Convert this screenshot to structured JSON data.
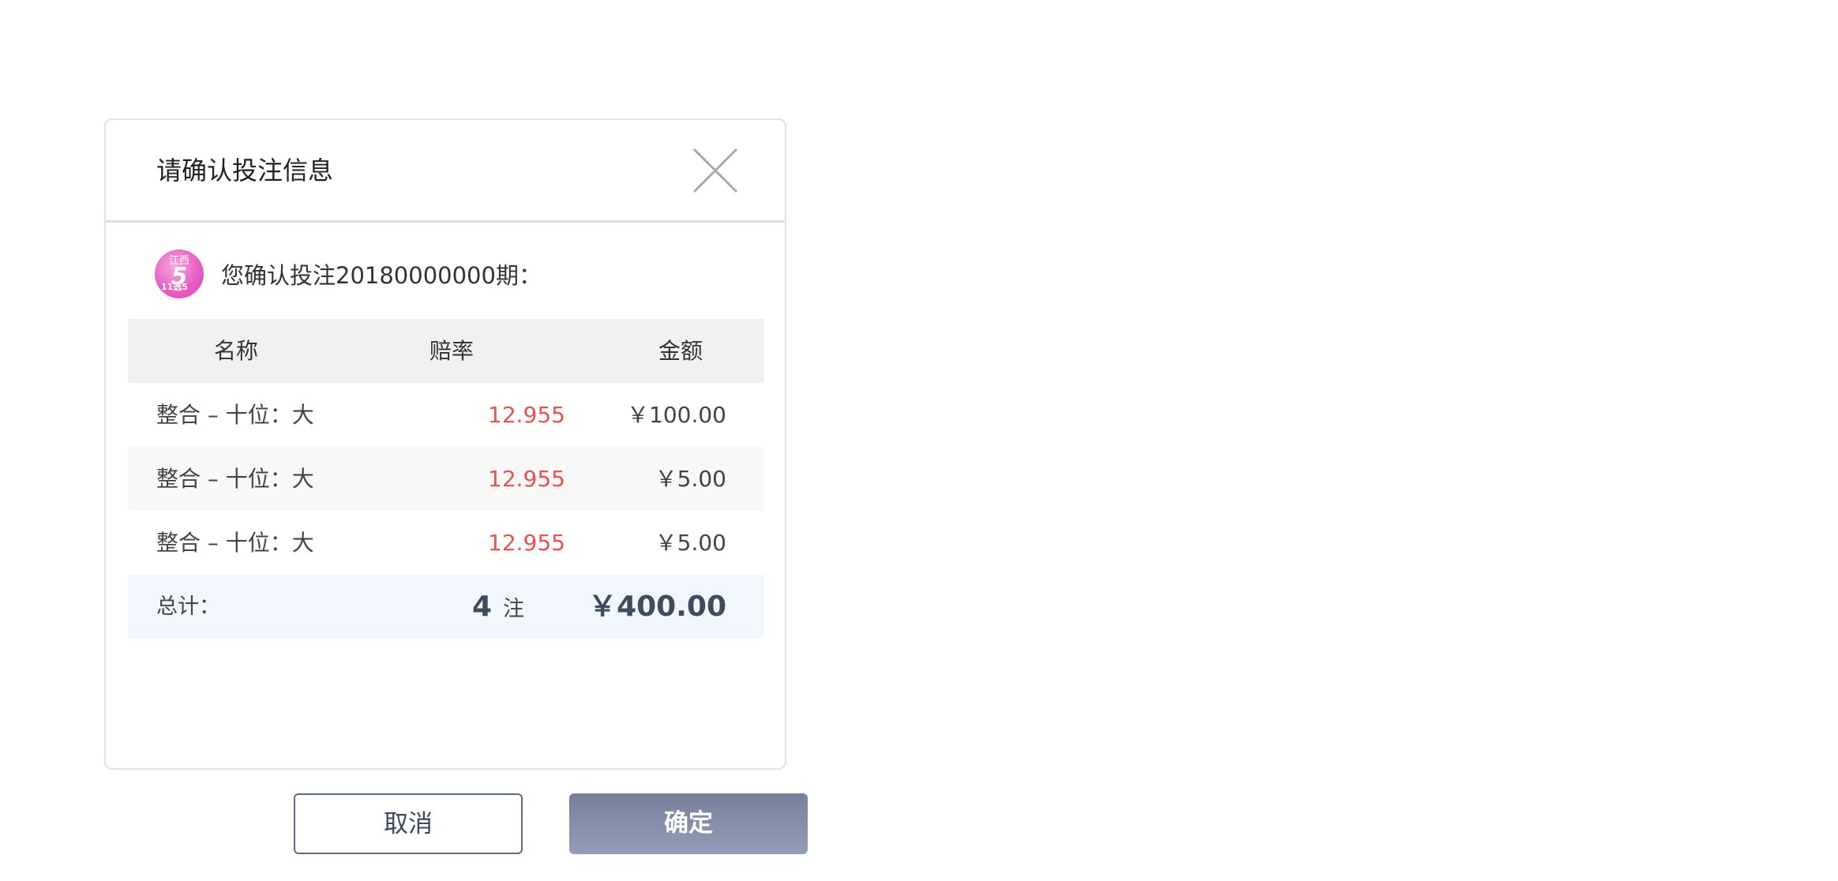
{
  "dialog": {
    "title": "请确认投注信息",
    "close_icon": "close-icon"
  },
  "intro": {
    "logo": {
      "top_text": "江西",
      "number": "5",
      "sub_text": "11选5"
    },
    "text": "您确认投注20180000000期："
  },
  "table": {
    "headers": {
      "name": "名称",
      "odds": "赔率",
      "amount": "金额"
    },
    "rows": [
      {
        "name": "整合 – 十位：大",
        "odds": "12.955",
        "amount": "￥100.00"
      },
      {
        "name": "整合 – 十位：大",
        "odds": "12.955",
        "amount": "￥5.00"
      },
      {
        "name": "整合 – 十位：大",
        "odds": "12.955",
        "amount": "￥5.00"
      }
    ],
    "total": {
      "label": "总计：",
      "count": "4",
      "count_unit": "注",
      "sum": "￥400.00"
    }
  },
  "buttons": {
    "cancel": "取消",
    "confirm": "确定"
  },
  "colors": {
    "odds": "#e9524e",
    "total_text": "#3f4c60",
    "confirm_bg": "#838da8",
    "cancel_border": "#5c6a82"
  }
}
